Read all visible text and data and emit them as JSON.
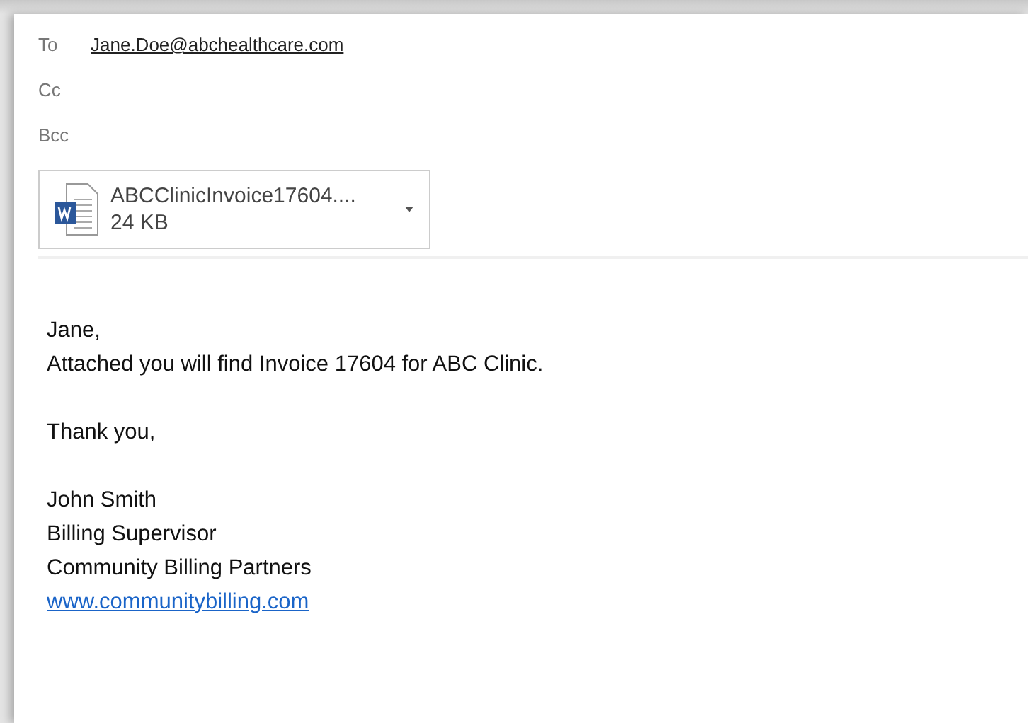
{
  "recipients": [
    {
      "label": "To",
      "value": "Jane.Doe@abchealthcare.com"
    },
    {
      "label": "Cc"
    },
    {
      "label": "Bcc"
    }
  ],
  "attachment": {
    "name": "ABCClinicInvoice17604....",
    "size": "24 KB"
  },
  "body": {
    "paragraphs": [
      [
        "Jane,",
        "Attached you will find Invoice 17604 for ABC Clinic."
      ],
      [
        "Thank you,"
      ],
      [
        "John Smith",
        "Billing Supervisor",
        "Community Billing Partners"
      ]
    ],
    "link": "www.communitybilling.com"
  }
}
